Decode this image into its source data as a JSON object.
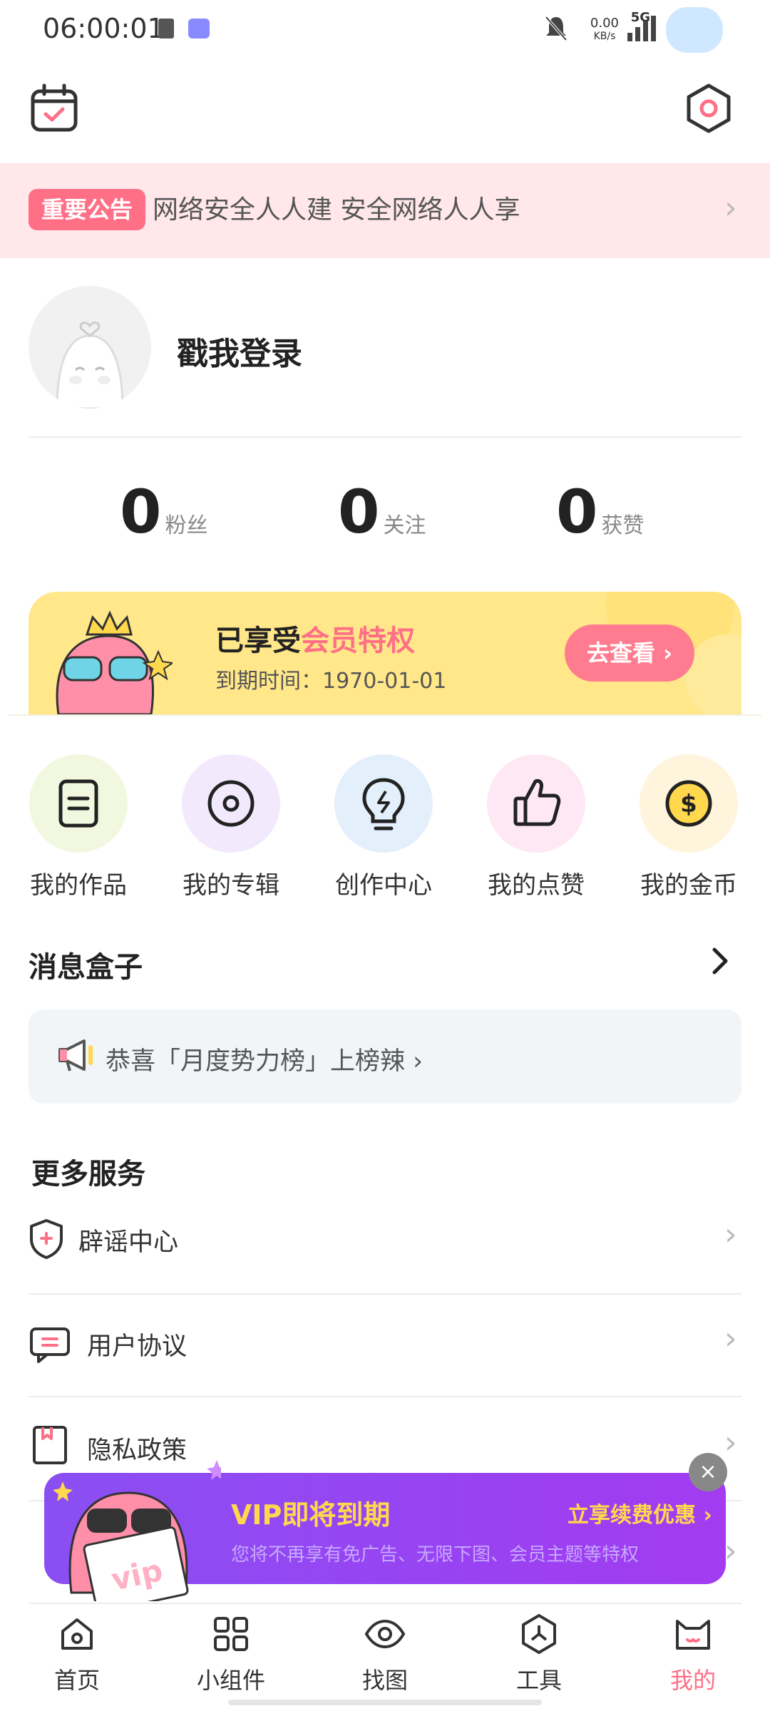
{
  "status_bar": {
    "time": "06:00:01",
    "net_speed_value": "0.00",
    "net_speed_unit": "KB/s",
    "network": "5G"
  },
  "header": {
    "left_icon": "calendar-check-icon",
    "right_icon": "settings-hexagon-icon"
  },
  "notice": {
    "badge": "重要公告",
    "text": "网络安全人人建 安全网络人人享"
  },
  "profile": {
    "login_text": "戳我登录"
  },
  "stats": [
    {
      "value": "0",
      "label": "粉丝"
    },
    {
      "value": "0",
      "label": "关注"
    },
    {
      "value": "0",
      "label": "获赞"
    }
  ],
  "vip_card": {
    "title_prefix": "已享受",
    "title_highlight": "会员特权",
    "expiry": "到期时间：1970-01-01",
    "button": "去查看"
  },
  "shortcuts": [
    {
      "label": "我的作品",
      "icon": "document-icon",
      "color": "#f1f8df"
    },
    {
      "label": "我的专辑",
      "icon": "disc-icon",
      "color": "#f3e9fd"
    },
    {
      "label": "创作中心",
      "icon": "lightbulb-icon",
      "color": "#e4effc"
    },
    {
      "label": "我的点赞",
      "icon": "thumbs-up-icon",
      "color": "#fde8f3"
    },
    {
      "label": "我的金币",
      "icon": "coin-icon",
      "color": "#fff4dc"
    }
  ],
  "messages": {
    "title": "消息盒子",
    "item": "恭喜「月度势力榜」上榜辣"
  },
  "services": {
    "title": "更多服务",
    "items": [
      {
        "label": "辟谣中心",
        "icon": "shield-icon"
      },
      {
        "label": "用户协议",
        "icon": "agreement-icon"
      },
      {
        "label": "隐私政策",
        "icon": "bookmark-icon"
      }
    ]
  },
  "vip_popup": {
    "title": "VIP即将到期",
    "subtitle": "您将不再享有免广告、无限下图、会员主题等特权",
    "link": "立享续费优惠",
    "badge_text": "vip"
  },
  "bottom_nav": [
    {
      "label": "首页",
      "icon": "home-icon",
      "active": false
    },
    {
      "label": "小组件",
      "icon": "widgets-icon",
      "active": false
    },
    {
      "label": "找图",
      "icon": "eye-icon",
      "active": false
    },
    {
      "label": "工具",
      "icon": "tools-icon",
      "active": false
    },
    {
      "label": "我的",
      "icon": "cat-face-icon",
      "active": true
    }
  ],
  "colors": {
    "accent_pink": "#ff6f86",
    "popup_purple": "#8a4ff2",
    "popup_gold": "#ffd84d",
    "vip_yellow": "#ffe78a"
  }
}
